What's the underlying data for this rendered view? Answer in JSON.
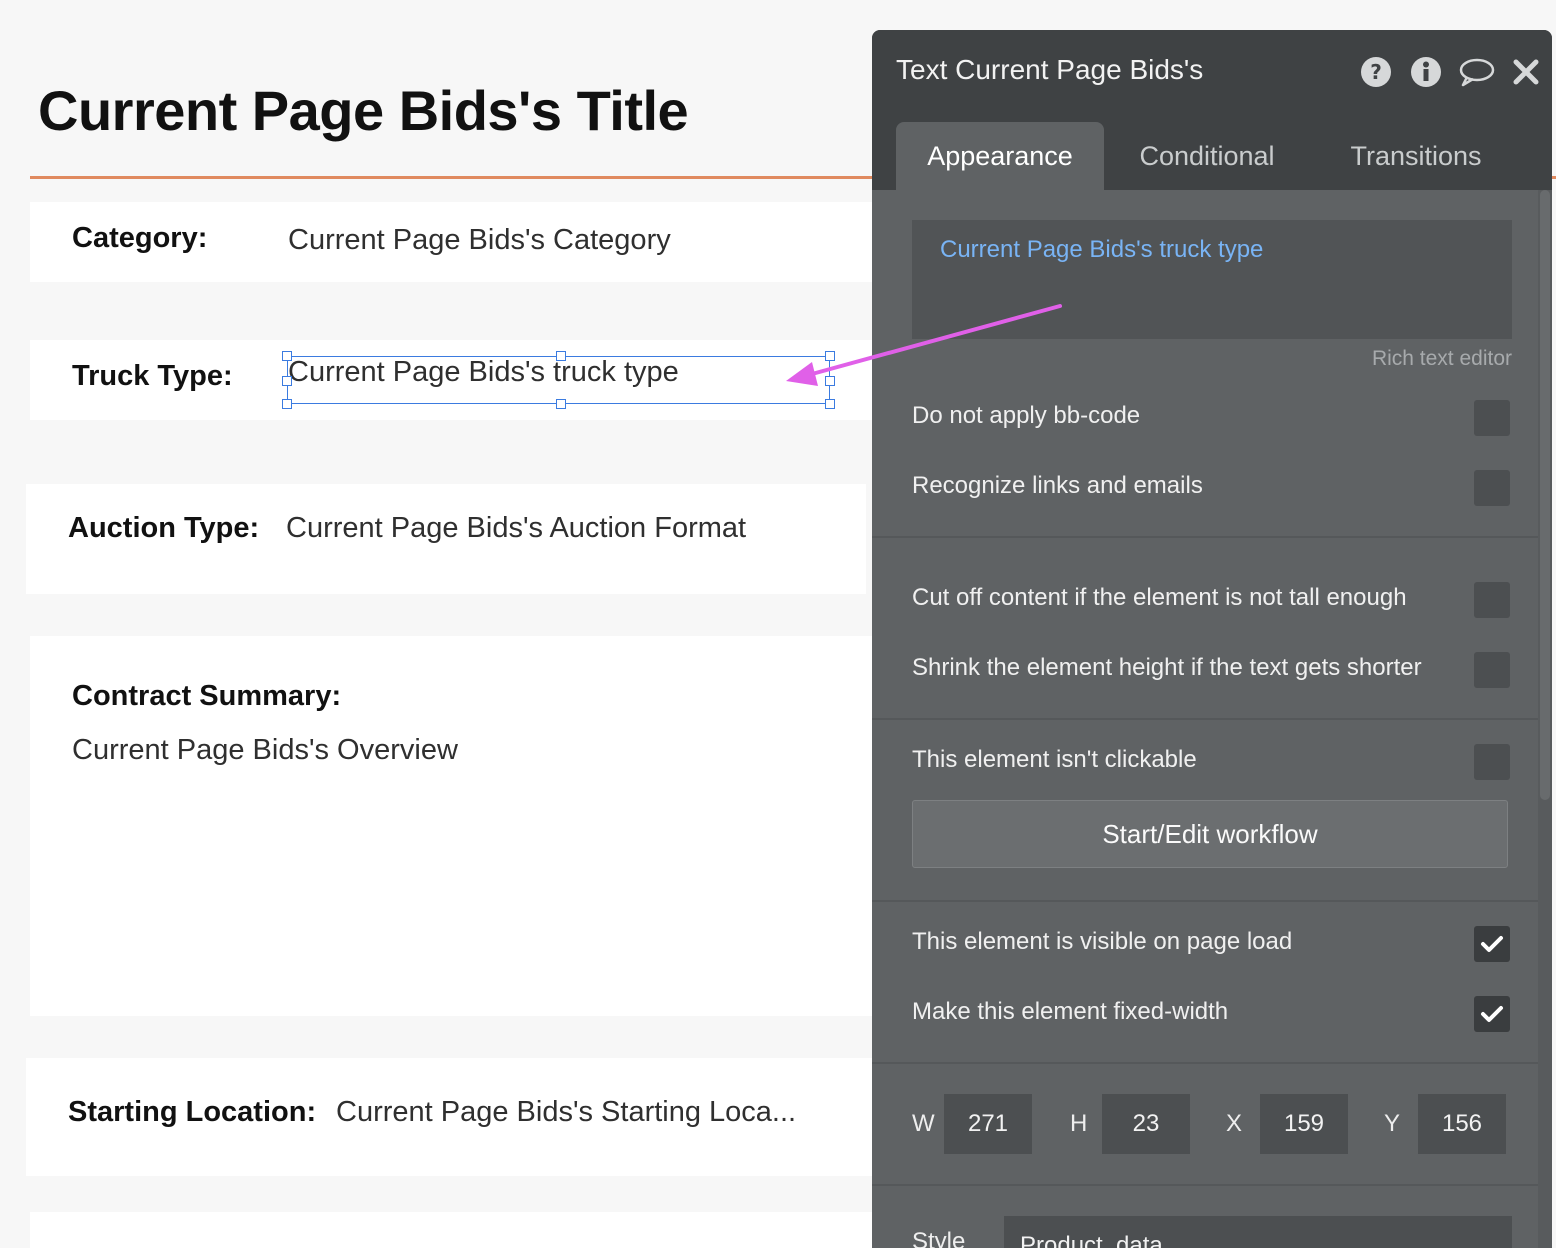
{
  "canvas": {
    "title": "Current Page Bids's Title",
    "fields": {
      "category": {
        "label": "Category:",
        "value": "Current Page Bids's Category"
      },
      "truck_type": {
        "label": "Truck Type:",
        "value": "Current Page Bids's truck type"
      },
      "auction_type": {
        "label": "Auction Type:",
        "value": "Current Page Bids's Auction Format"
      },
      "contract_summary": {
        "label": "Contract Summary:",
        "value": "Current Page Bids's Overview"
      },
      "starting_location": {
        "label": "Starting Location:",
        "value": "Current Page Bids's Starting Loca..."
      }
    },
    "accent_color": "#e08a5f",
    "selection_color": "#3b7be0",
    "annotation_arrow_color": "#e060e8"
  },
  "panel": {
    "title": "Text Current Page Bids's",
    "header_icons": [
      "help-icon",
      "info-icon",
      "comment-icon",
      "close-icon"
    ],
    "tabs": [
      {
        "label": "Appearance",
        "active": true
      },
      {
        "label": "Conditional",
        "active": false
      },
      {
        "label": "Transitions",
        "active": false
      }
    ],
    "rich_text": {
      "content": "Current Page Bids's truck type",
      "caption": "Rich text editor",
      "content_color": "#79b4f5"
    },
    "options": [
      {
        "label": "Do not apply bb-code",
        "checked": false
      },
      {
        "label": "Recognize links and emails",
        "checked": false
      },
      {
        "label": "Cut off content if the element is not tall enough",
        "checked": false
      },
      {
        "label": "Shrink the element height if the text gets shorter",
        "checked": false
      },
      {
        "label": "This element isn't clickable",
        "checked": false
      },
      {
        "label": "This element is visible on page load",
        "checked": true
      },
      {
        "label": "Make this element fixed-width",
        "checked": true
      }
    ],
    "workflow_button": "Start/Edit workflow",
    "dimensions": {
      "w_label": "W",
      "w_value": "271",
      "h_label": "H",
      "h_value": "23",
      "x_label": "X",
      "x_value": "159",
      "y_label": "Y",
      "y_value": "156"
    },
    "style": {
      "label": "Style",
      "value": "Product_data"
    }
  }
}
